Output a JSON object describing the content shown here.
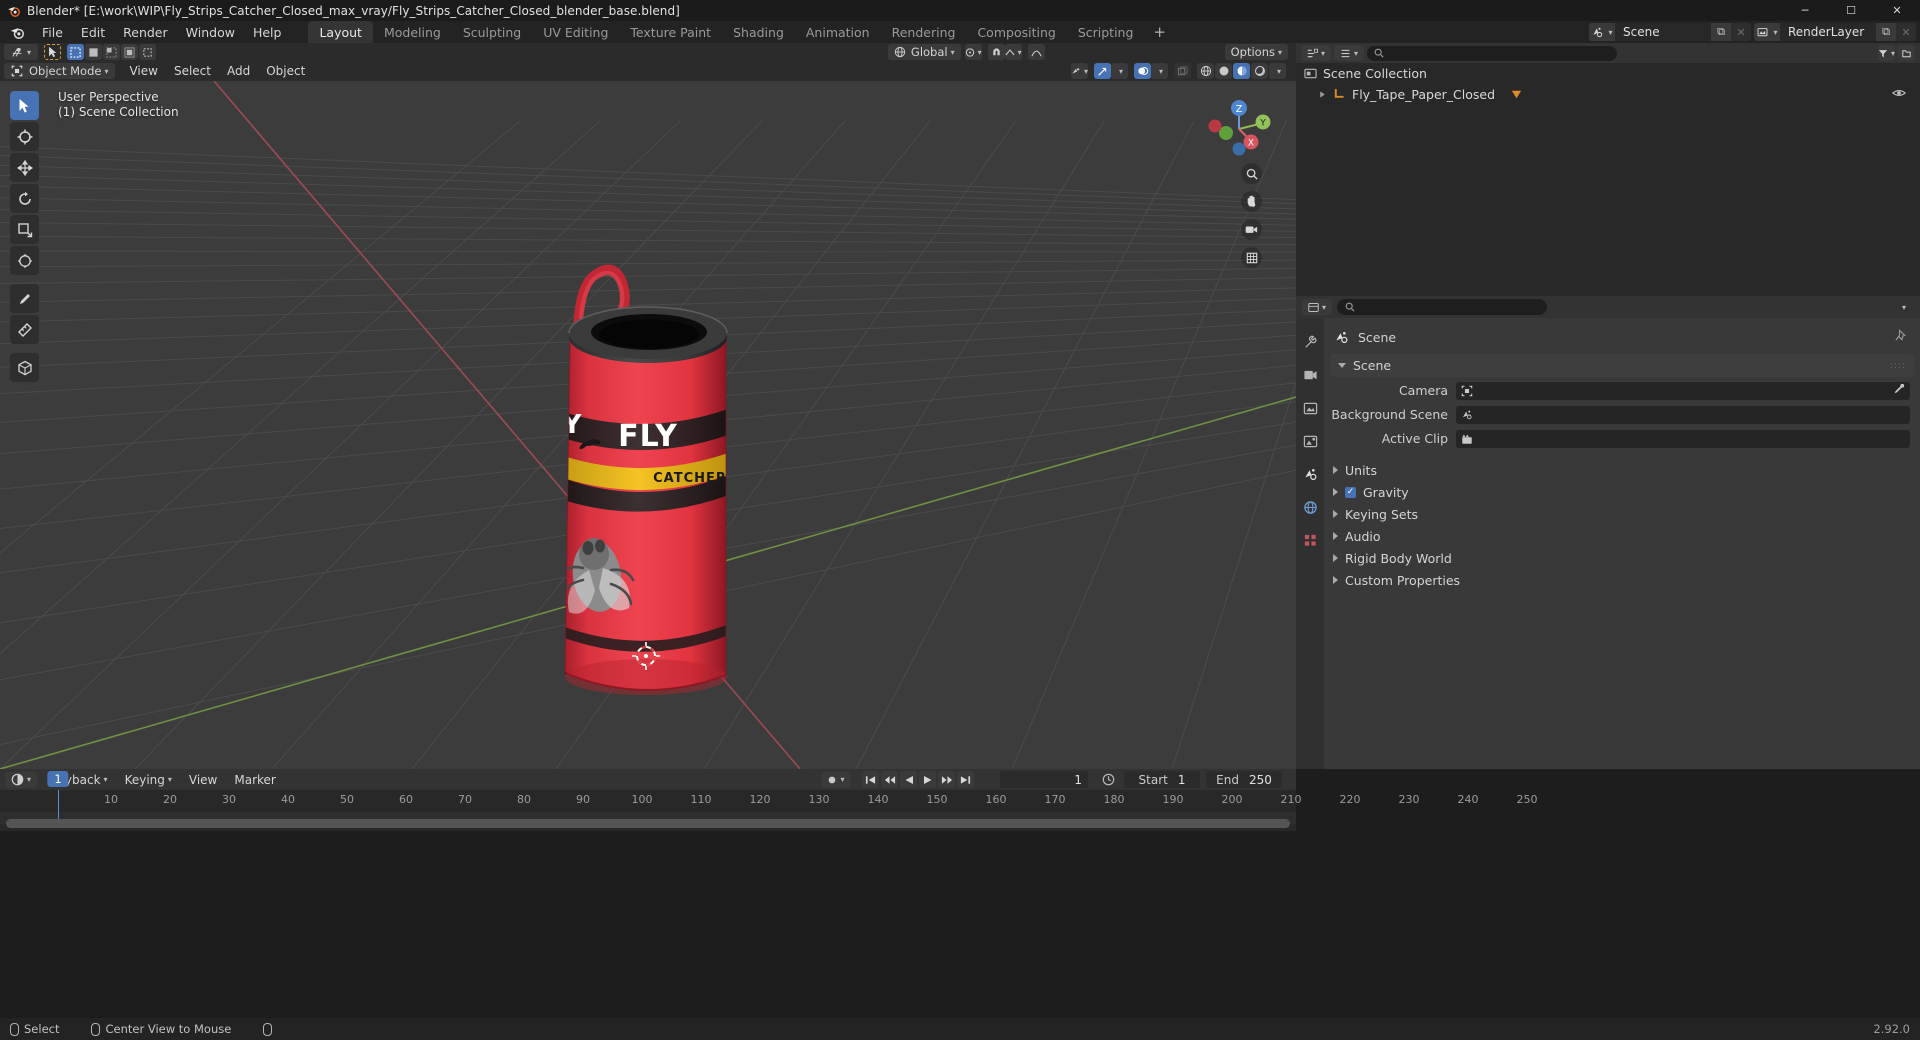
{
  "window": {
    "title": "Blender* [E:\\work\\WIP\\Fly_Strips_Catcher_Closed_max_vray/Fly_Strips_Catcher_Closed_blender_base.blend]",
    "minimize": "─",
    "maximize": "☐",
    "close": "✕"
  },
  "menubar": {
    "items": [
      "File",
      "Edit",
      "Render",
      "Window",
      "Help"
    ]
  },
  "workspaces": {
    "tabs": [
      "Layout",
      "Modeling",
      "Sculpting",
      "UV Editing",
      "Texture Paint",
      "Shading",
      "Animation",
      "Rendering",
      "Compositing",
      "Scripting"
    ],
    "active": "Layout",
    "add_label": "+"
  },
  "topbar_right": {
    "scene_name": "Scene",
    "viewlayer_name": "RenderLayer",
    "new_btn": "⧉",
    "unlink_btn": "✕"
  },
  "viewport_header": {
    "editor_type_icon": "editor-type-icon",
    "transform_orientation": "Global",
    "mode": "Object Mode",
    "menus": [
      "View",
      "Select",
      "Add",
      "Object"
    ],
    "options_label": "Options"
  },
  "viewport": {
    "perspective_label": "User Perspective",
    "collection_label": "(1) Scene Collection",
    "gizmo_axes": {
      "z": "Z",
      "y": "Y",
      "x": "X"
    }
  },
  "outliner": {
    "rows": [
      {
        "label": "Scene Collection",
        "icon": "collection-icon",
        "depth": 0
      },
      {
        "label": "Fly_Tape_Paper_Closed",
        "icon": "mesh-object-icon",
        "depth": 1
      }
    ],
    "filter_icon": "filter-icon",
    "search_placeholder": ""
  },
  "properties": {
    "breadcrumb": "Scene",
    "panel_scene": "Scene",
    "rows": [
      {
        "label": "Camera",
        "value": "",
        "icon": "camera-icon",
        "picker": true
      },
      {
        "label": "Background Scene",
        "value": "",
        "icon": "scene-icon",
        "picker": false
      },
      {
        "label": "Active Clip",
        "value": "",
        "icon": "clip-icon",
        "picker": false
      }
    ],
    "closed_panels": [
      "Units",
      "Keying Sets",
      "Audio",
      "Rigid Body World",
      "Custom Properties"
    ],
    "gravity_label": "Gravity",
    "gravity_checked": true,
    "tabs": [
      "tool-icon",
      "render-icon",
      "output-icon",
      "viewlayer-icon",
      "scene-icon",
      "world-icon",
      "texture-icon"
    ]
  },
  "timeline": {
    "menus": [
      "Playback",
      "Keying",
      "View",
      "Marker"
    ],
    "current_frame": "1",
    "start_label": "Start",
    "start_value": "1",
    "end_label": "End",
    "end_value": "250",
    "ticks": [
      "10",
      "20",
      "30",
      "40",
      "50",
      "60",
      "70",
      "80",
      "90",
      "100",
      "110",
      "120",
      "130",
      "140",
      "150",
      "160",
      "170",
      "180",
      "190",
      "200",
      "210",
      "220",
      "230",
      "240",
      "250"
    ],
    "play_buttons": [
      "jump-start",
      "prev-keyframe",
      "play-reverse",
      "play",
      "next-keyframe",
      "jump-end"
    ]
  },
  "statusbar": {
    "items": [
      {
        "icon": "mouse-left-icon",
        "label": "Select"
      },
      {
        "icon": "mouse-middle-icon",
        "label": "Center View to Mouse"
      },
      {
        "icon": "mouse-right-icon",
        "label": ""
      }
    ],
    "version": "2.92.0"
  },
  "colors": {
    "accent": "#4772b3",
    "orange": "#e08a28",
    "viewport_bg": "#3c3c3c",
    "model_red": "#e03a46"
  }
}
